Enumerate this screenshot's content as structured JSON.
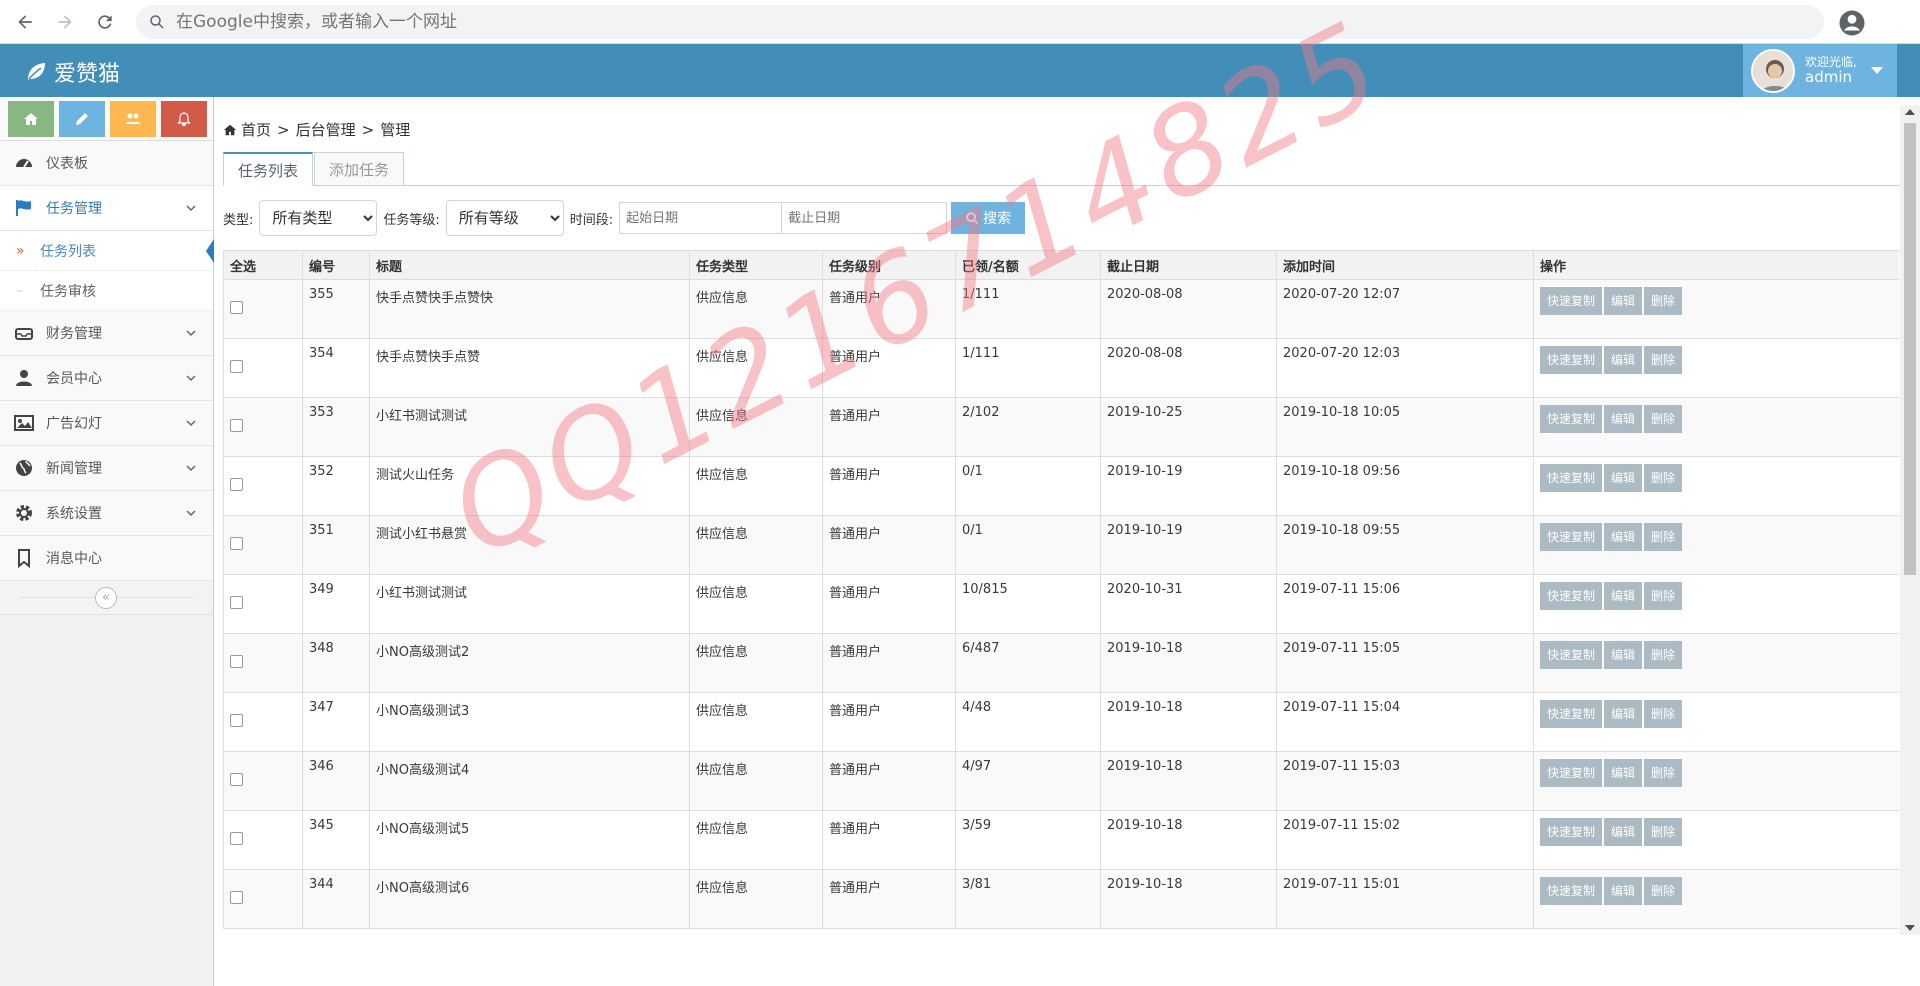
{
  "browser": {
    "address_placeholder": "在Google中搜索，或者输入一个网址"
  },
  "header": {
    "brand": "爱赞猫",
    "welcome": "欢迎光临,",
    "username": "admin"
  },
  "sidebar": {
    "shortcut_colors": [
      "#87b87f",
      "#6fb3e0",
      "#ffb752",
      "#d15b47"
    ],
    "items": [
      {
        "label": "仪表板",
        "icon": "dashboard-icon"
      },
      {
        "label": "任务管理",
        "icon": "flag-icon"
      },
      {
        "label": "财务管理",
        "icon": "inbox-icon"
      },
      {
        "label": "会员中心",
        "icon": "user-icon"
      },
      {
        "label": "广告幻灯",
        "icon": "picture-icon"
      },
      {
        "label": "新闻管理",
        "icon": "globe-icon"
      },
      {
        "label": "系统设置",
        "icon": "cog-icon"
      },
      {
        "label": "消息中心",
        "icon": "bookmark-icon"
      }
    ],
    "subitems": [
      {
        "label": "任务列表"
      },
      {
        "label": "任务审核"
      }
    ]
  },
  "breadcrumb": {
    "home": "首页",
    "level1": "后台管理",
    "level2": "管理"
  },
  "tabs": {
    "list": "任务列表",
    "add": "添加任务"
  },
  "filter": {
    "type_label": "类型:",
    "type_value": "所有类型",
    "level_label": "任务等级:",
    "level_value": "所有等级",
    "period_label": "时间段:",
    "start_placeholder": "起始日期",
    "end_placeholder": "截止日期",
    "search_label": "搜索"
  },
  "table": {
    "headers": [
      "全选",
      "编号",
      "标题",
      "任务类型",
      "任务级别",
      "已领/名额",
      "截止日期",
      "添加时间",
      "操作"
    ],
    "actions": [
      "快速复制",
      "编辑",
      "删除"
    ],
    "rows": [
      {
        "id": "355",
        "title": "快手点赞快手点赞快",
        "type": "供应信息",
        "level": "普通用户",
        "quota": "1/111",
        "deadline": "2020-08-08",
        "added": "2020-07-20 12:07"
      },
      {
        "id": "354",
        "title": "快手点赞快手点赞",
        "type": "供应信息",
        "level": "普通用户",
        "quota": "1/111",
        "deadline": "2020-08-08",
        "added": "2020-07-20 12:03"
      },
      {
        "id": "353",
        "title": "小红书测试测试",
        "type": "供应信息",
        "level": "普通用户",
        "quota": "2/102",
        "deadline": "2019-10-25",
        "added": "2019-10-18 10:05"
      },
      {
        "id": "352",
        "title": "测试火山任务",
        "type": "供应信息",
        "level": "普通用户",
        "quota": "0/1",
        "deadline": "2019-10-19",
        "added": "2019-10-18 09:56"
      },
      {
        "id": "351",
        "title": "测试小红书悬赏",
        "type": "供应信息",
        "level": "普通用户",
        "quota": "0/1",
        "deadline": "2019-10-19",
        "added": "2019-10-18 09:55"
      },
      {
        "id": "349",
        "title": "小红书测试测试",
        "type": "供应信息",
        "level": "普通用户",
        "quota": "10/815",
        "deadline": "2020-10-31",
        "added": "2019-07-11 15:06"
      },
      {
        "id": "348",
        "title": "小NO高级测试2",
        "type": "供应信息",
        "level": "普通用户",
        "quota": "6/487",
        "deadline": "2019-10-18",
        "added": "2019-07-11 15:05"
      },
      {
        "id": "347",
        "title": "小NO高级测试3",
        "type": "供应信息",
        "level": "普通用户",
        "quota": "4/48",
        "deadline": "2019-10-18",
        "added": "2019-07-11 15:04"
      },
      {
        "id": "346",
        "title": "小NO高级测试4",
        "type": "供应信息",
        "level": "普通用户",
        "quota": "4/97",
        "deadline": "2019-10-18",
        "added": "2019-07-11 15:03"
      },
      {
        "id": "345",
        "title": "小NO高级测试5",
        "type": "供应信息",
        "level": "普通用户",
        "quota": "3/59",
        "deadline": "2019-10-18",
        "added": "2019-07-11 15:02"
      },
      {
        "id": "344",
        "title": "小NO高级测试6",
        "type": "供应信息",
        "level": "普通用户",
        "quota": "3/81",
        "deadline": "2019-10-18",
        "added": "2019-07-11 15:01"
      }
    ]
  },
  "watermark": "QQ1216714825"
}
